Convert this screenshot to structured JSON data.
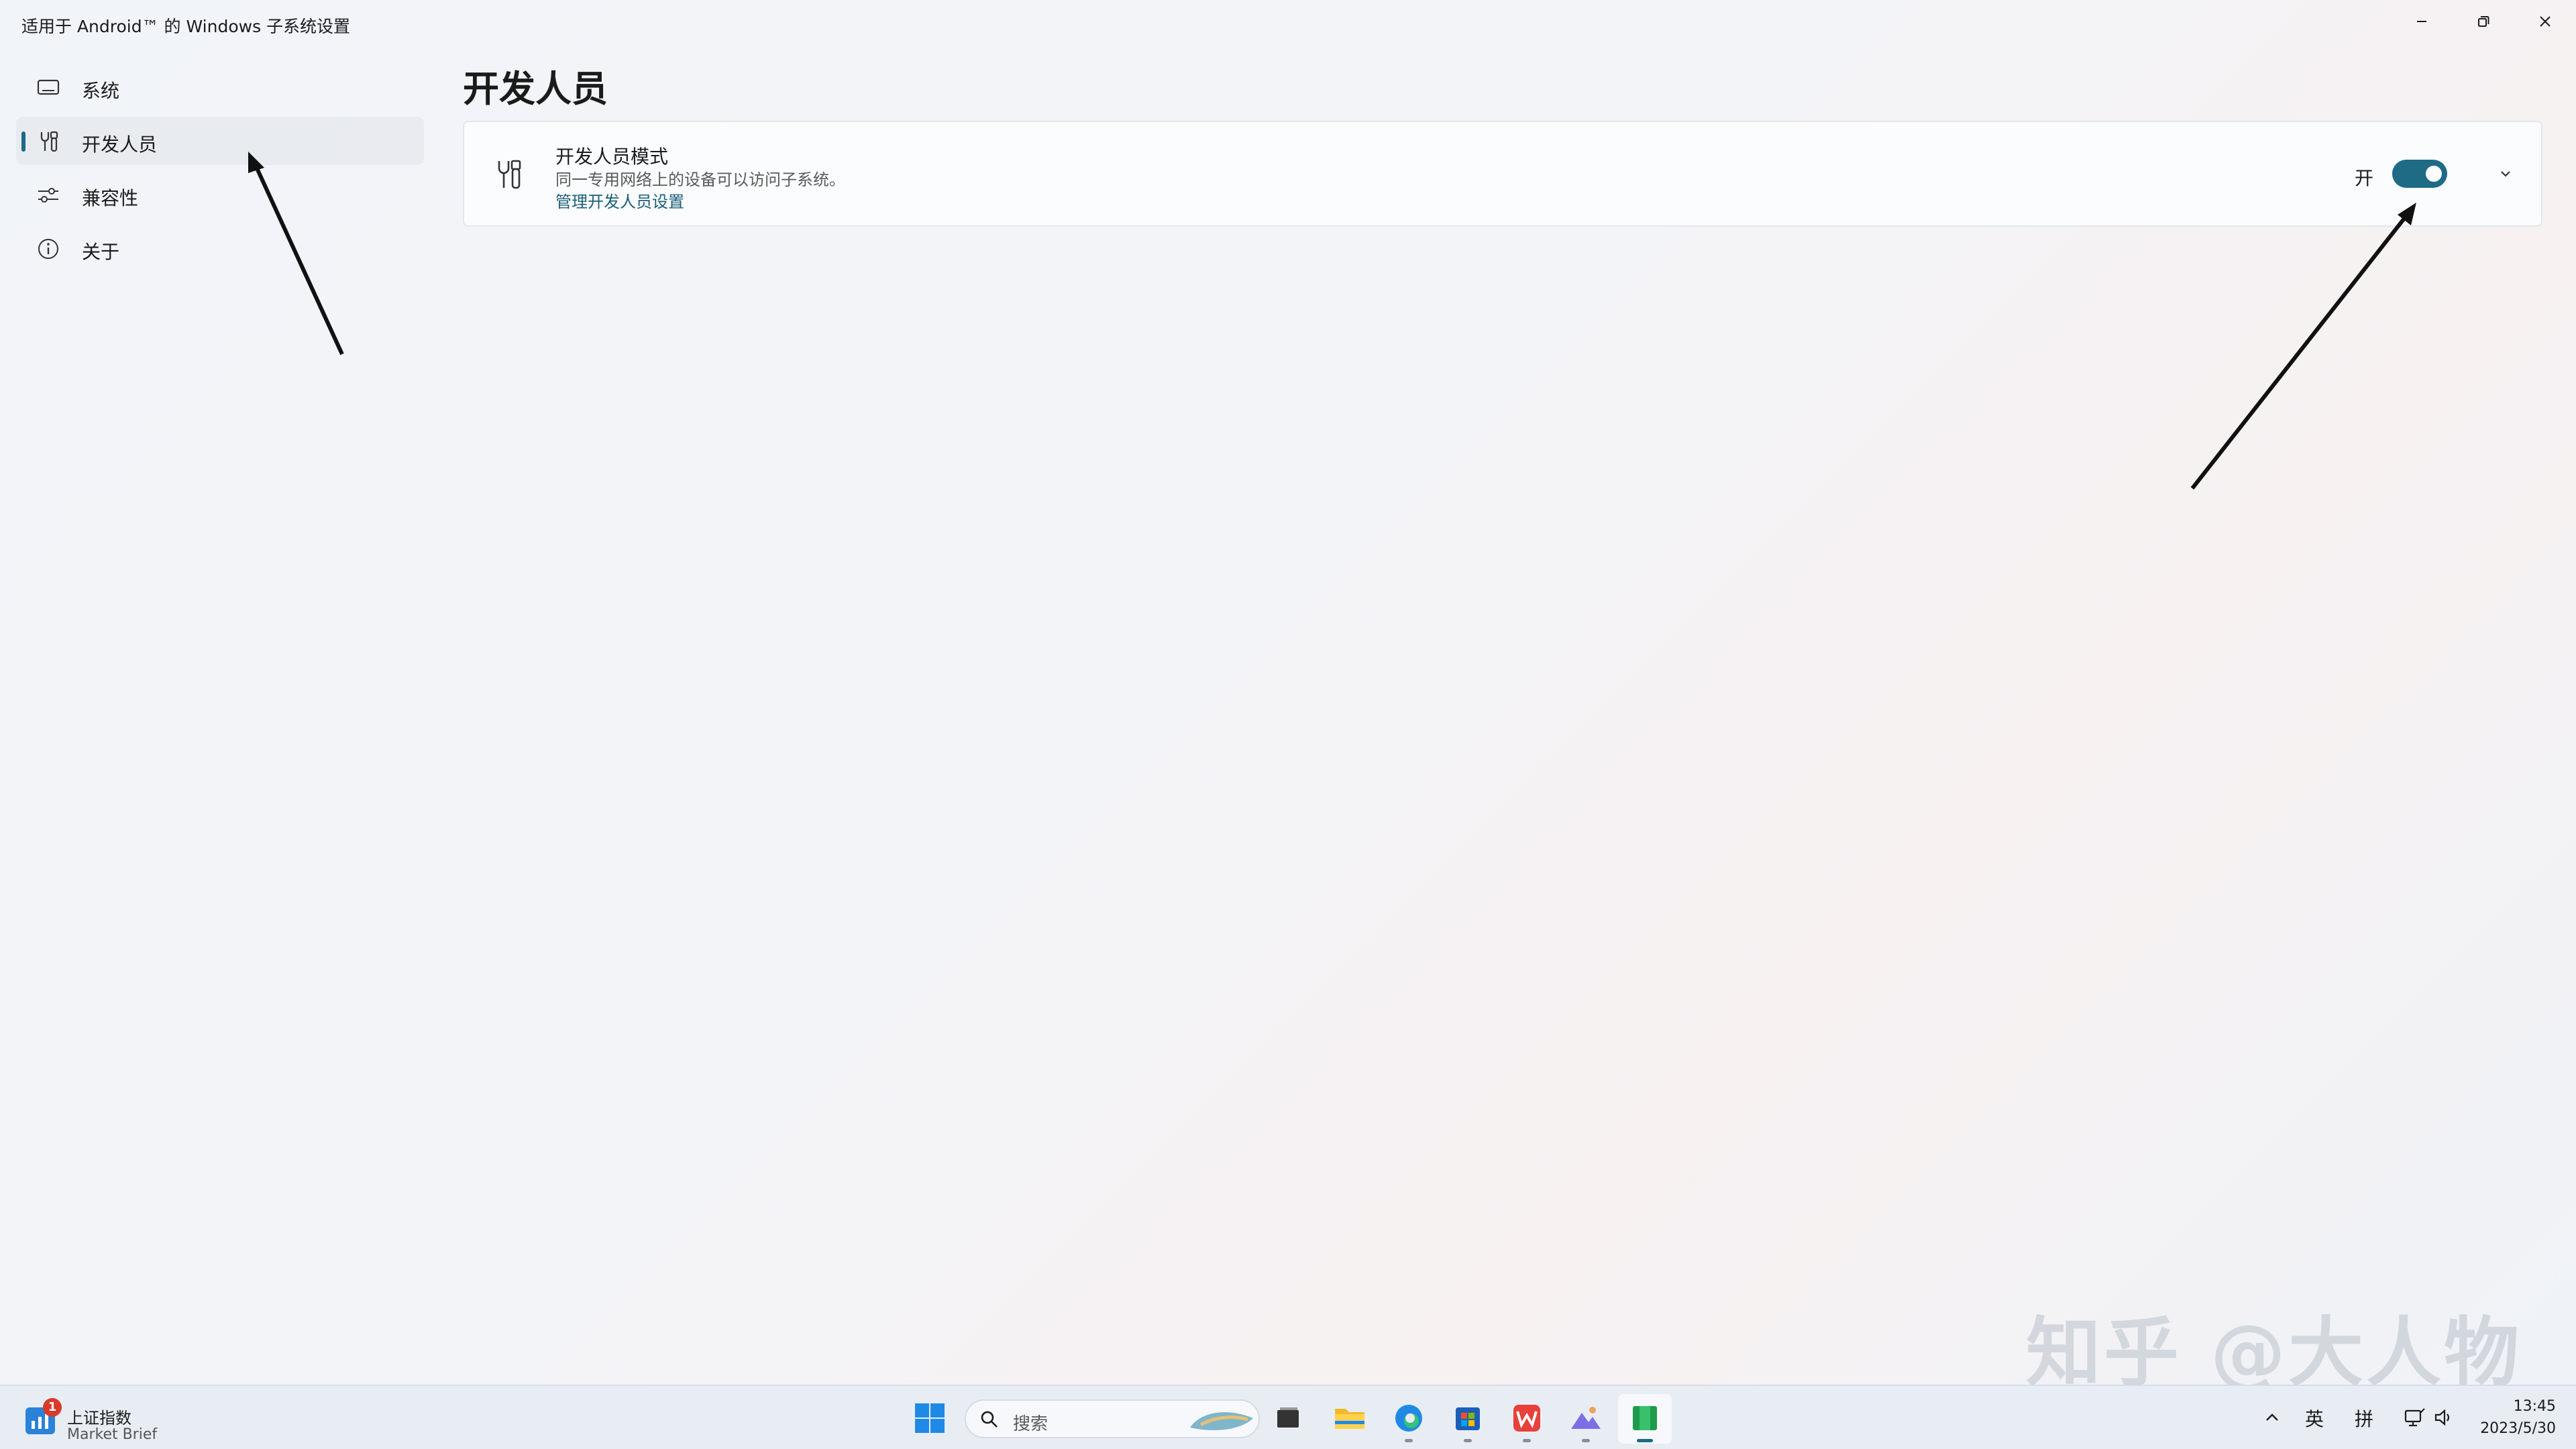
{
  "window": {
    "title": "适用于 Android™ 的 Windows 子系统设置"
  },
  "sidebar": {
    "items": [
      {
        "label": "系统",
        "icon": "monitor-icon"
      },
      {
        "label": "开发人员",
        "icon": "developer-tools-icon",
        "selected": true
      },
      {
        "label": "兼容性",
        "icon": "sliders-icon"
      },
      {
        "label": "关于",
        "icon": "info-icon"
      }
    ]
  },
  "main": {
    "page_title": "开发人员",
    "developer_mode": {
      "title": "开发人员模式",
      "description": "同一专用网络上的设备可以访问子系统。",
      "link": "管理开发人员设置",
      "toggle_label": "开",
      "toggle_on": true
    }
  },
  "watermark": "知乎 @大人物",
  "taskbar": {
    "widget": {
      "badge": "1",
      "title": "上证指数",
      "subtitle": "Market Brief"
    },
    "search_placeholder": "搜索",
    "apps": [
      "start-icon",
      "file-explorer-icon",
      "folder-icon",
      "edge-icon",
      "store-icon",
      "wps-icon",
      "photos-icon",
      "wsa-settings-icon"
    ],
    "tray": {
      "lang1": "英",
      "lang2": "拼",
      "time": "13:45",
      "date": "2023/5/30"
    }
  },
  "colors": {
    "accent": "#1d6b85",
    "link": "#1a5f78",
    "background": "#f2f4f8"
  }
}
